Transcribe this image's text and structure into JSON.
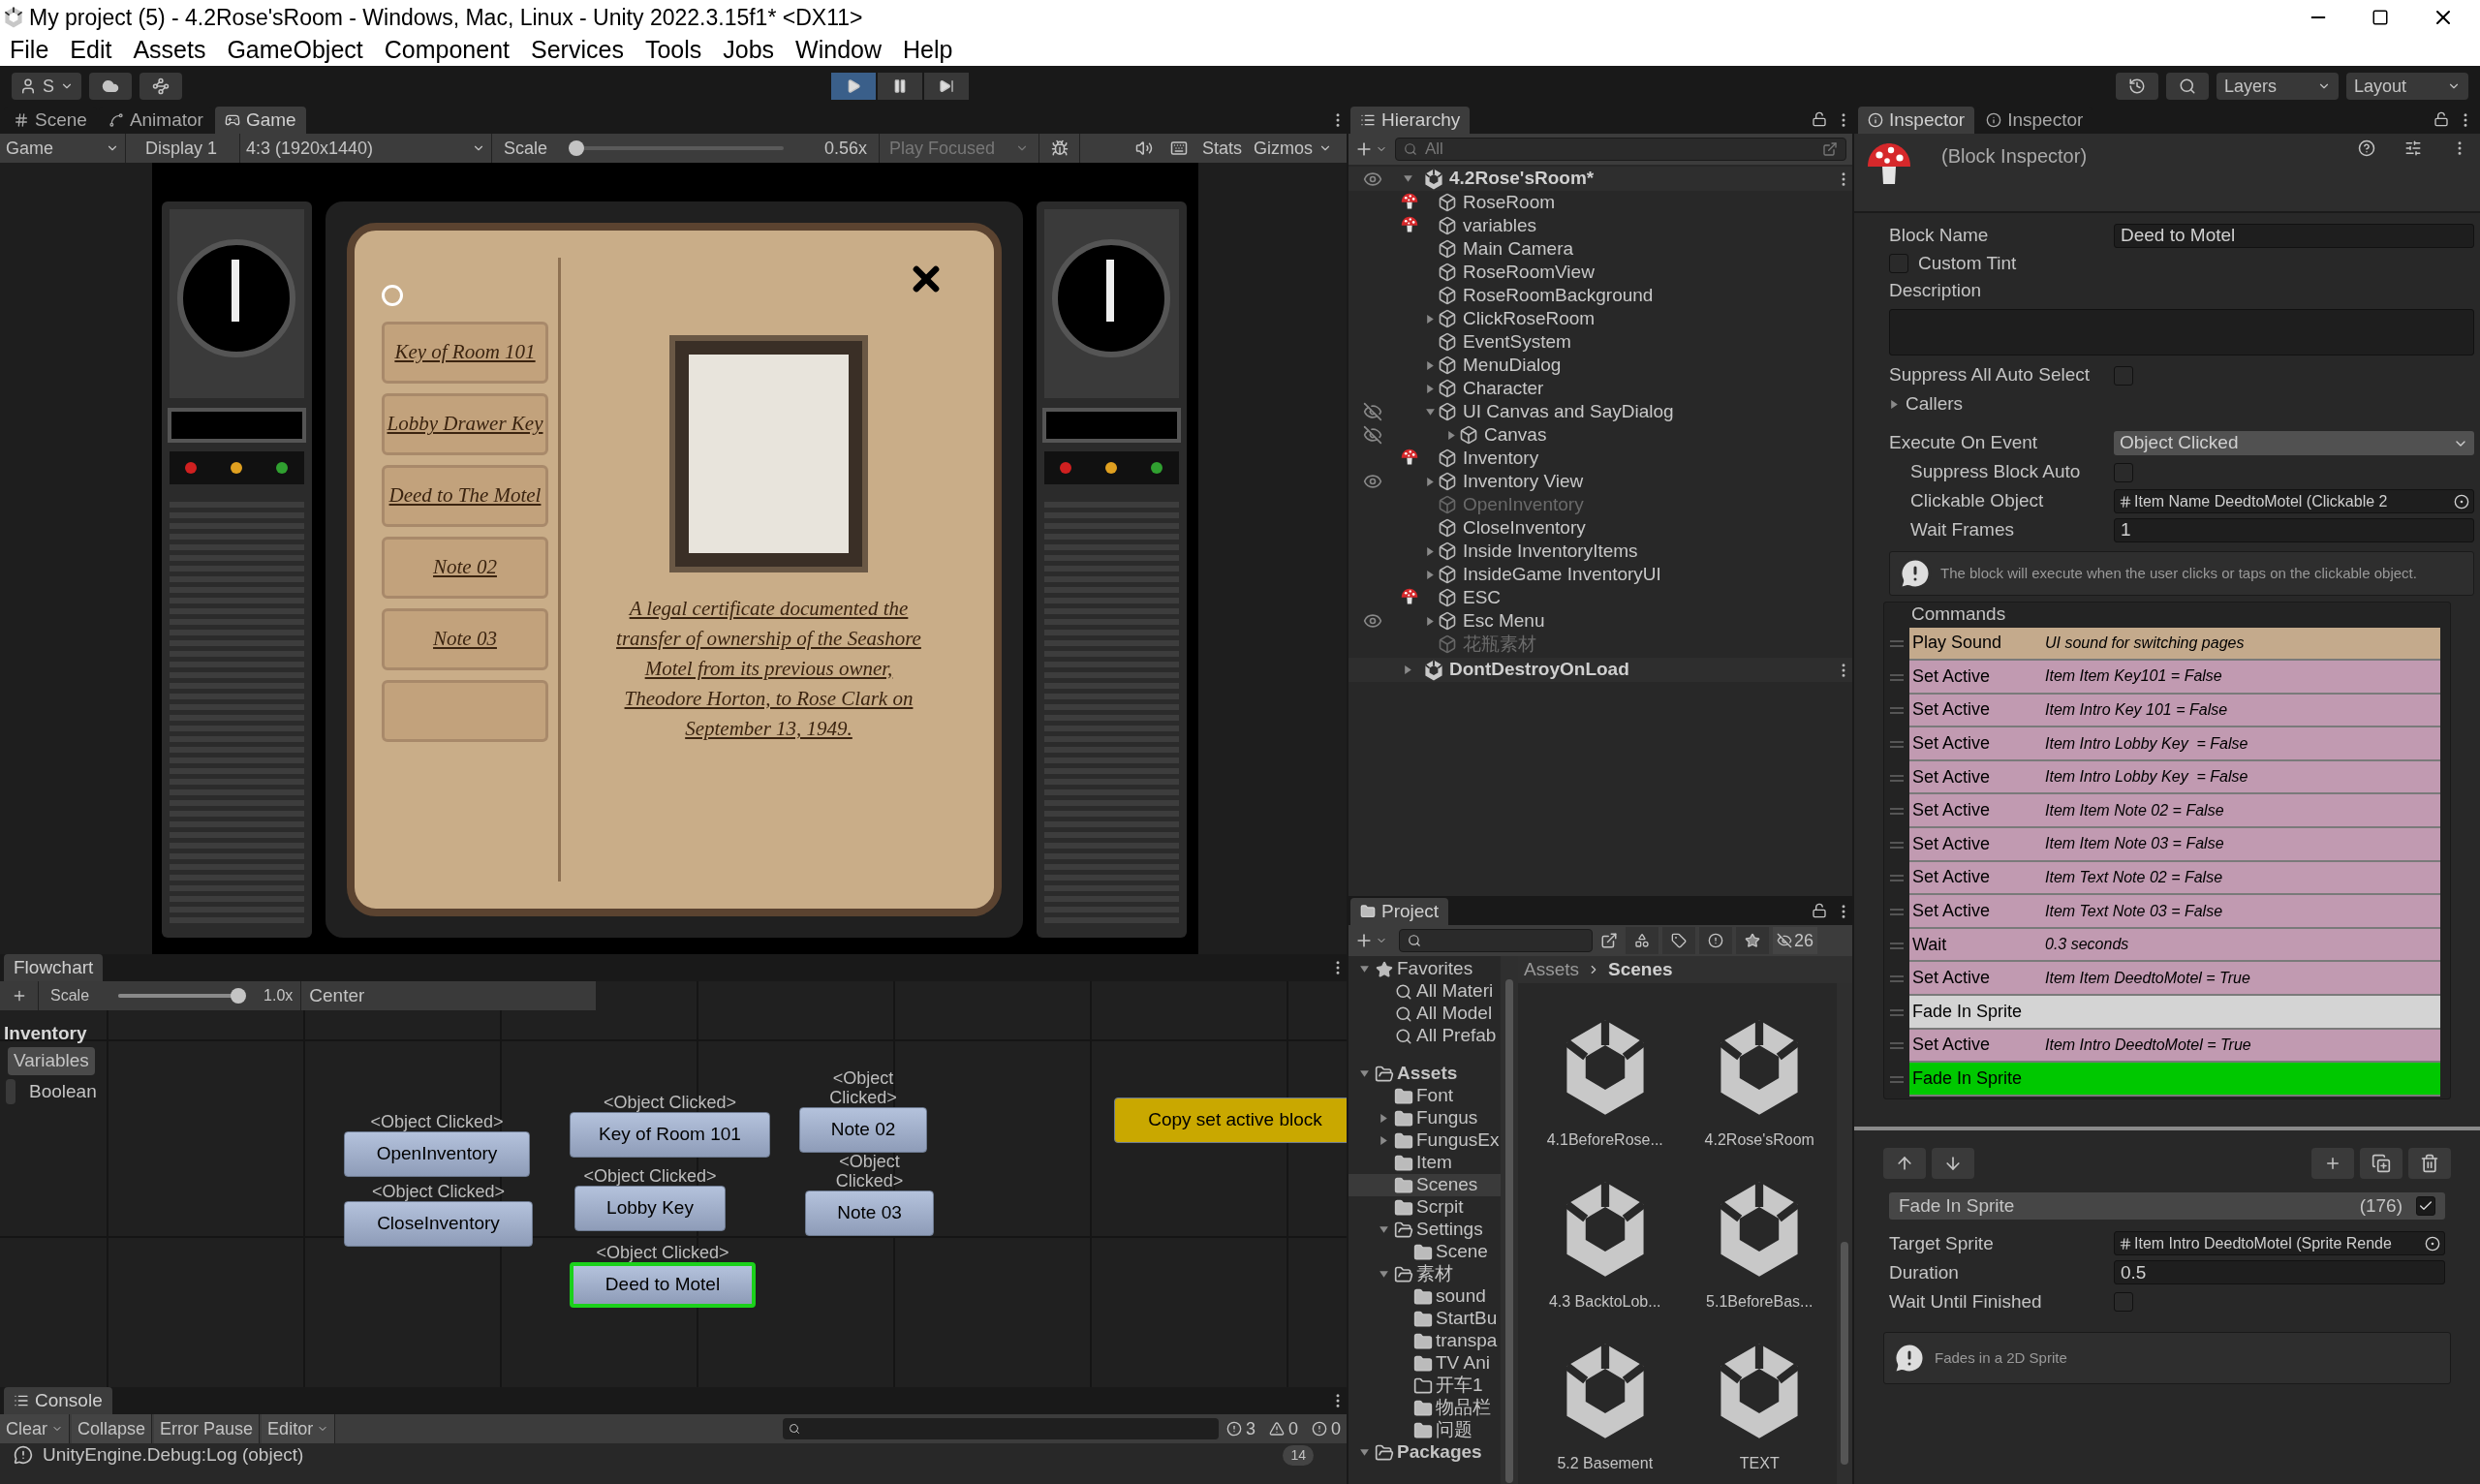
{
  "window": {
    "title": "My project (5) - 4.2Rose'sRoom - Windows, Mac, Linux - Unity 2022.3.15f1* <DX11>"
  },
  "menu": [
    "File",
    "Edit",
    "Assets",
    "GameObject",
    "Component",
    "Services",
    "Tools",
    "Jobs",
    "Window",
    "Help"
  ],
  "toolbar": {
    "account": "S",
    "play_controls": [
      {
        "kind": "play",
        "selected": true
      },
      {
        "kind": "pause",
        "selected": false
      },
      {
        "kind": "step",
        "selected": false
      }
    ],
    "layers": "Layers",
    "layout": "Layout"
  },
  "game_panel": {
    "tabs": [
      {
        "kind": "scene",
        "label": "Scene",
        "selected": false
      },
      {
        "kind": "animator",
        "label": "Animator",
        "selected": false
      },
      {
        "kind": "game",
        "label": "Game",
        "selected": true
      }
    ],
    "display_mode": "Game",
    "display": "Display 1",
    "aspect": "4:3 (1920x1440)",
    "scale_label": "Scale",
    "scale": {
      "level": 0
    },
    "scale_reading": "0.56x",
    "play_focused": "Play Focused",
    "stats": "Stats",
    "gizmos": "Gizmos",
    "inventory": {
      "items": [
        {
          "label": "Key of Room 101"
        },
        {
          "label": "Lobby Drawer Key"
        },
        {
          "label": "Deed to The Motel"
        },
        {
          "label": "Note 02"
        },
        {
          "label": "Note 03"
        }
      ],
      "description": "A legal certificate documented the transfer of ownership of the Seashore Motel from its previous owner, Theodore Horton, to Rose Clark on September 13, 1949."
    }
  },
  "flowchart": {
    "title": "Flowchart",
    "scale_label": "Scale",
    "scale": {
      "level": 1
    },
    "scale_reading": "1.0x",
    "center": "Center",
    "name": "Inventory",
    "variables_tab": "Variables",
    "variables": [
      "Boolean"
    ],
    "blocks": [
      {
        "kind": "event",
        "event": "<Object Clicked>",
        "name": "OpenInventory",
        "selected": false
      },
      {
        "kind": "event",
        "event": "<Object Clicked>",
        "name": "CloseInventory",
        "selected": false
      },
      {
        "kind": "event",
        "event": "<Object Clicked>",
        "name": "Key of Room 101",
        "selected": false
      },
      {
        "kind": "event",
        "event": "<Object Clicked>",
        "name": "Lobby Key",
        "selected": false
      },
      {
        "kind": "event",
        "event": "<Object Clicked>",
        "name": "Deed to Motel",
        "selected": true
      },
      {
        "kind": "event",
        "event": "<Object Clicked>",
        "name": "Note 02",
        "selected": false
      },
      {
        "kind": "event",
        "event": "<Object Clicked>",
        "name": "Note 03",
        "selected": false
      },
      {
        "kind": "plain",
        "name": "Copy set active block",
        "selected": false,
        "color": "#c9a800"
      }
    ]
  },
  "console": {
    "title": "Console",
    "buttons": [
      "Clear",
      "Collapse",
      "Error Pause",
      "Editor"
    ],
    "counts": [
      {
        "kind": "info",
        "count": "3"
      },
      {
        "kind": "warning",
        "count": "0"
      },
      {
        "kind": "error",
        "count": "0"
      }
    ],
    "log": "UnityEngine.Debug:Log (object)",
    "log_count": "14"
  },
  "hierarchy": {
    "title": "Hierarchy",
    "search_placeholder": "All",
    "scenes": [
      {
        "name": "4.2Rose'sRoom*",
        "expanded": true,
        "hidden": false,
        "children": [
          {
            "name": "RoseRoom",
            "fungus": true,
            "disabled": false
          },
          {
            "name": "variables",
            "fungus": true,
            "disabled": false
          },
          {
            "name": "Main Camera",
            "fungus": false,
            "disabled": false
          },
          {
            "name": "RoseRoomView",
            "fungus": false,
            "disabled": false
          },
          {
            "name": "RoseRoomBackground",
            "fungus": false,
            "disabled": false
          },
          {
            "name": "ClickRoseRoom",
            "expanded": false,
            "fungus": false,
            "disabled": false
          },
          {
            "name": "EventSystem",
            "fungus": false,
            "disabled": false
          },
          {
            "name": "MenuDialog",
            "expanded": false,
            "fungus": false,
            "disabled": false
          },
          {
            "name": "Character",
            "expanded": false,
            "fungus": false,
            "disabled": false
          },
          {
            "name": "UI Canvas and SayDialog",
            "expanded": true,
            "hidden": true,
            "fungus": false,
            "disabled": false,
            "children": [
              {
                "name": "Canvas",
                "expanded": false,
                "hidden": true,
                "fungus": false,
                "disabled": false
              }
            ]
          },
          {
            "name": "Inventory",
            "fungus": true,
            "disabled": false
          },
          {
            "name": "Inventory View",
            "expanded": false,
            "hidden": false,
            "fungus": false,
            "disabled": false
          },
          {
            "name": "OpenInventory",
            "fungus": false,
            "disabled": true
          },
          {
            "name": "CloseInventory",
            "fungus": false,
            "disabled": false
          },
          {
            "name": "Inside InventoryItems",
            "expanded": false,
            "fungus": false,
            "disabled": false
          },
          {
            "name": "InsideGame InventoryUI",
            "expanded": false,
            "fungus": false,
            "disabled": false
          },
          {
            "name": "ESC",
            "fungus": true,
            "disabled": false
          },
          {
            "name": "Esc Menu",
            "expanded": false,
            "hidden": false,
            "fungus": false,
            "disabled": false
          },
          {
            "name": "花瓶素材",
            "fungus": false,
            "disabled": true
          }
        ]
      },
      {
        "name": "DontDestroyOnLoad",
        "expanded": false
      }
    ]
  },
  "project": {
    "title": "Project",
    "hidden_count": "26",
    "tree": [
      {
        "kind": "favorites",
        "label": "Favorites",
        "expanded": true,
        "selected": false,
        "children": [
          {
            "kind": "search",
            "label": "All Materi",
            "selected": false
          },
          {
            "kind": "search",
            "label": "All Model",
            "selected": false
          },
          {
            "kind": "search",
            "label": "All Prefab",
            "selected": false
          }
        ]
      },
      {
        "kind": "folder",
        "label": "Assets",
        "expanded": true,
        "selected": false,
        "bold": true,
        "children": [
          {
            "kind": "folder",
            "label": "Font",
            "selected": false
          },
          {
            "kind": "folder",
            "label": "Fungus",
            "expanded": false,
            "selected": false
          },
          {
            "kind": "folder",
            "label": "FungusEx",
            "expanded": false,
            "selected": false
          },
          {
            "kind": "folder",
            "label": "Item",
            "selected": false
          },
          {
            "kind": "folder",
            "label": "Scenes",
            "selected": true
          },
          {
            "kind": "folder",
            "label": "Scrpit",
            "selected": false
          },
          {
            "kind": "folder",
            "label": "Settings",
            "expanded": true,
            "selected": false,
            "children": [
              {
                "kind": "folder",
                "label": "Scene",
                "selected": false
              }
            ]
          },
          {
            "kind": "folder",
            "label": "素材",
            "expanded": true,
            "selected": false,
            "children": [
              {
                "kind": "folder",
                "label": "sound",
                "selected": false
              },
              {
                "kind": "folder",
                "label": "StartBu",
                "selected": false
              },
              {
                "kind": "folder",
                "label": "transpa",
                "selected": false
              },
              {
                "kind": "folder",
                "label": "TV Ani",
                "selected": false
              },
              {
                "kind": "empty_folder",
                "label": "开车1",
                "selected": false
              },
              {
                "kind": "folder",
                "label": "物品栏",
                "selected": false
              },
              {
                "kind": "folder",
                "label": "问题",
                "selected": false
              }
            ]
          }
        ]
      },
      {
        "kind": "folder",
        "label": "Packages",
        "expanded": true,
        "selected": false,
        "bold": true
      }
    ],
    "breadcrumb": [
      "Assets",
      "Scenes"
    ],
    "files": [
      "4.1BeforeRose...",
      "4.2Rose'sRoom",
      "4.3 BacktoLob...",
      "5.1BeforeBas...",
      "5.2 Basement",
      "TEXT"
    ]
  },
  "inspector": {
    "tabs": [
      {
        "label": "Inspector",
        "selected": true
      },
      {
        "label": "Inspector",
        "selected": false
      }
    ],
    "header": "(Block Inspector)",
    "fields": [
      {
        "kind": "text",
        "label": "Block Name",
        "value": "Deed to Motel"
      },
      {
        "kind": "checkbox",
        "label": "Custom Tint",
        "checked": false
      },
      {
        "kind": "textarea",
        "label": "Description"
      },
      {
        "kind": "check_after",
        "label": "Suppress All Auto Select",
        "checked": false
      },
      {
        "kind": "foldout",
        "label": "Callers",
        "expanded": false
      },
      {
        "kind": "dropdown",
        "label": "Execute On Event",
        "value": "Object Clicked",
        "children": [
          {
            "kind": "check_after",
            "label": "Suppress Block Auto",
            "checked": false
          },
          {
            "kind": "object",
            "label": "Clickable Object",
            "value": "Item Name DeedtoMotel (Clickable 2"
          },
          {
            "kind": "text",
            "label": "Wait Frames",
            "value": "1"
          }
        ]
      }
    ],
    "help": "The block will execute when the user clicks or taps on the clickable object.",
    "commands_title": "Commands",
    "commands": [
      {
        "name": "Play Sound",
        "summary": "UI sound for switching pages",
        "color": "#c4aa8c",
        "selected": false
      },
      {
        "name": "Set Active",
        "summary": "Item Item Key101 = False",
        "color": "#c19ab1",
        "selected": false
      },
      {
        "name": "Set Active",
        "summary": "Item Intro Key 101 = False",
        "color": "#c19ab1",
        "selected": false
      },
      {
        "name": "Set Active",
        "summary": "Item Intro Lobby Key  = False",
        "color": "#c19ab1",
        "selected": false
      },
      {
        "name": "Set Active",
        "summary": "Item Intro Lobby Key  = False",
        "color": "#c19ab1",
        "selected": false
      },
      {
        "name": "Set Active",
        "summary": "Item Item Note 02 = False",
        "color": "#c19ab1",
        "selected": false
      },
      {
        "name": "Set Active",
        "summary": "Item Item Note 03 = False",
        "color": "#c19ab1",
        "selected": false
      },
      {
        "name": "Set Active",
        "summary": "Item Text Note 02 = False",
        "color": "#c19ab1",
        "selected": false
      },
      {
        "name": "Set Active",
        "summary": "Item Text Note 03 = False",
        "color": "#c19ab1",
        "selected": false
      },
      {
        "name": "Wait",
        "summary": "0.3 seconds",
        "color": "#c19ab1",
        "selected": false
      },
      {
        "name": "Set Active",
        "summary": "Item Item DeedtoMotel = True",
        "color": "#c19ab1",
        "selected": false
      },
      {
        "name": "Fade In Sprite",
        "color": "#d4d4d4",
        "selected": false
      },
      {
        "name": "Set Active",
        "summary": "Item Intro DeedtoMotel = True",
        "color": "#c19ab1",
        "selected": false
      },
      {
        "name": "Fade In Sprite",
        "selected": true
      }
    ],
    "command": {
      "name": "Fade In Sprite",
      "index": "(176)",
      "enabled": true,
      "fields": [
        {
          "kind": "object",
          "label": "Target Sprite",
          "value": "Item Intro DeedtoMotel (Sprite Rende"
        },
        {
          "kind": "text",
          "label": "Duration",
          "value": "0.5"
        },
        {
          "kind": "checkbox_right",
          "label": "Wait Until Finished",
          "checked": false
        }
      ],
      "help": "Fades in a 2D Sprite"
    }
  }
}
